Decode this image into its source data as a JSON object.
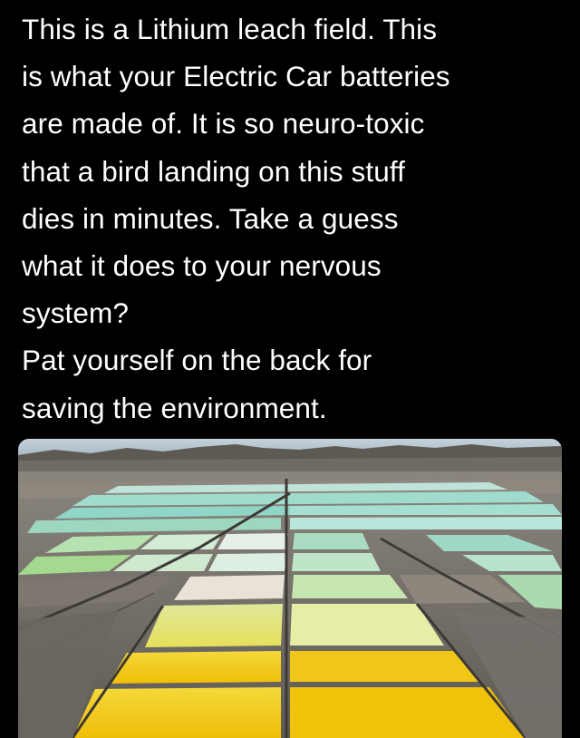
{
  "tweet": {
    "text_lines": [
      "This is a Lithium leach field. This",
      "is what your Electric Car batteries",
      "are made of. It is so neuro-toxic",
      "that a bird landing on this stuff",
      "dies in minutes. Take a guess",
      "what it does to your nervous",
      "system?",
      "Pat yourself on the back for",
      "saving the environment."
    ]
  },
  "media": {
    "scene": "lithium-evaporation-ponds",
    "colors": {
      "sky": "#aebfcc",
      "mountains": "#5a5650",
      "ground": "#7a746c",
      "pond_teal": "#8fd6c8",
      "pond_green": "#a9d8a0",
      "pond_lime": "#d8e27a",
      "pond_yellow": "#f2cf18",
      "pond_deep_yellow": "#f0c20a",
      "salt_crust": "#e9e4dc"
    }
  }
}
